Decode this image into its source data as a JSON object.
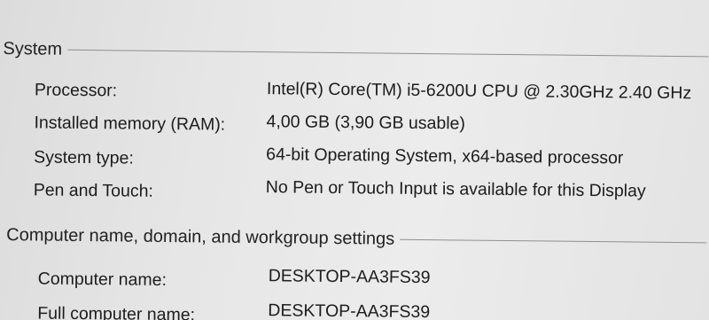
{
  "system": {
    "heading": "System",
    "rows": [
      {
        "label": "Processor:",
        "value": "Intel(R) Core(TM) i5-6200U CPU @ 2.30GHz   2.40 GHz"
      },
      {
        "label": "Installed memory (RAM):",
        "value": "4,00 GB (3,90 GB usable)"
      },
      {
        "label": "System type:",
        "value": "64-bit Operating System, x64-based processor"
      },
      {
        "label": "Pen and Touch:",
        "value": "No Pen or Touch Input is available for this Display"
      }
    ]
  },
  "computer": {
    "heading": "Computer name, domain, and workgroup settings",
    "rows": [
      {
        "label": "Computer name:",
        "value": "DESKTOP-AA3FS39"
      },
      {
        "label": "Full computer name:",
        "value": "DESKTOP-AA3FS39"
      }
    ]
  }
}
